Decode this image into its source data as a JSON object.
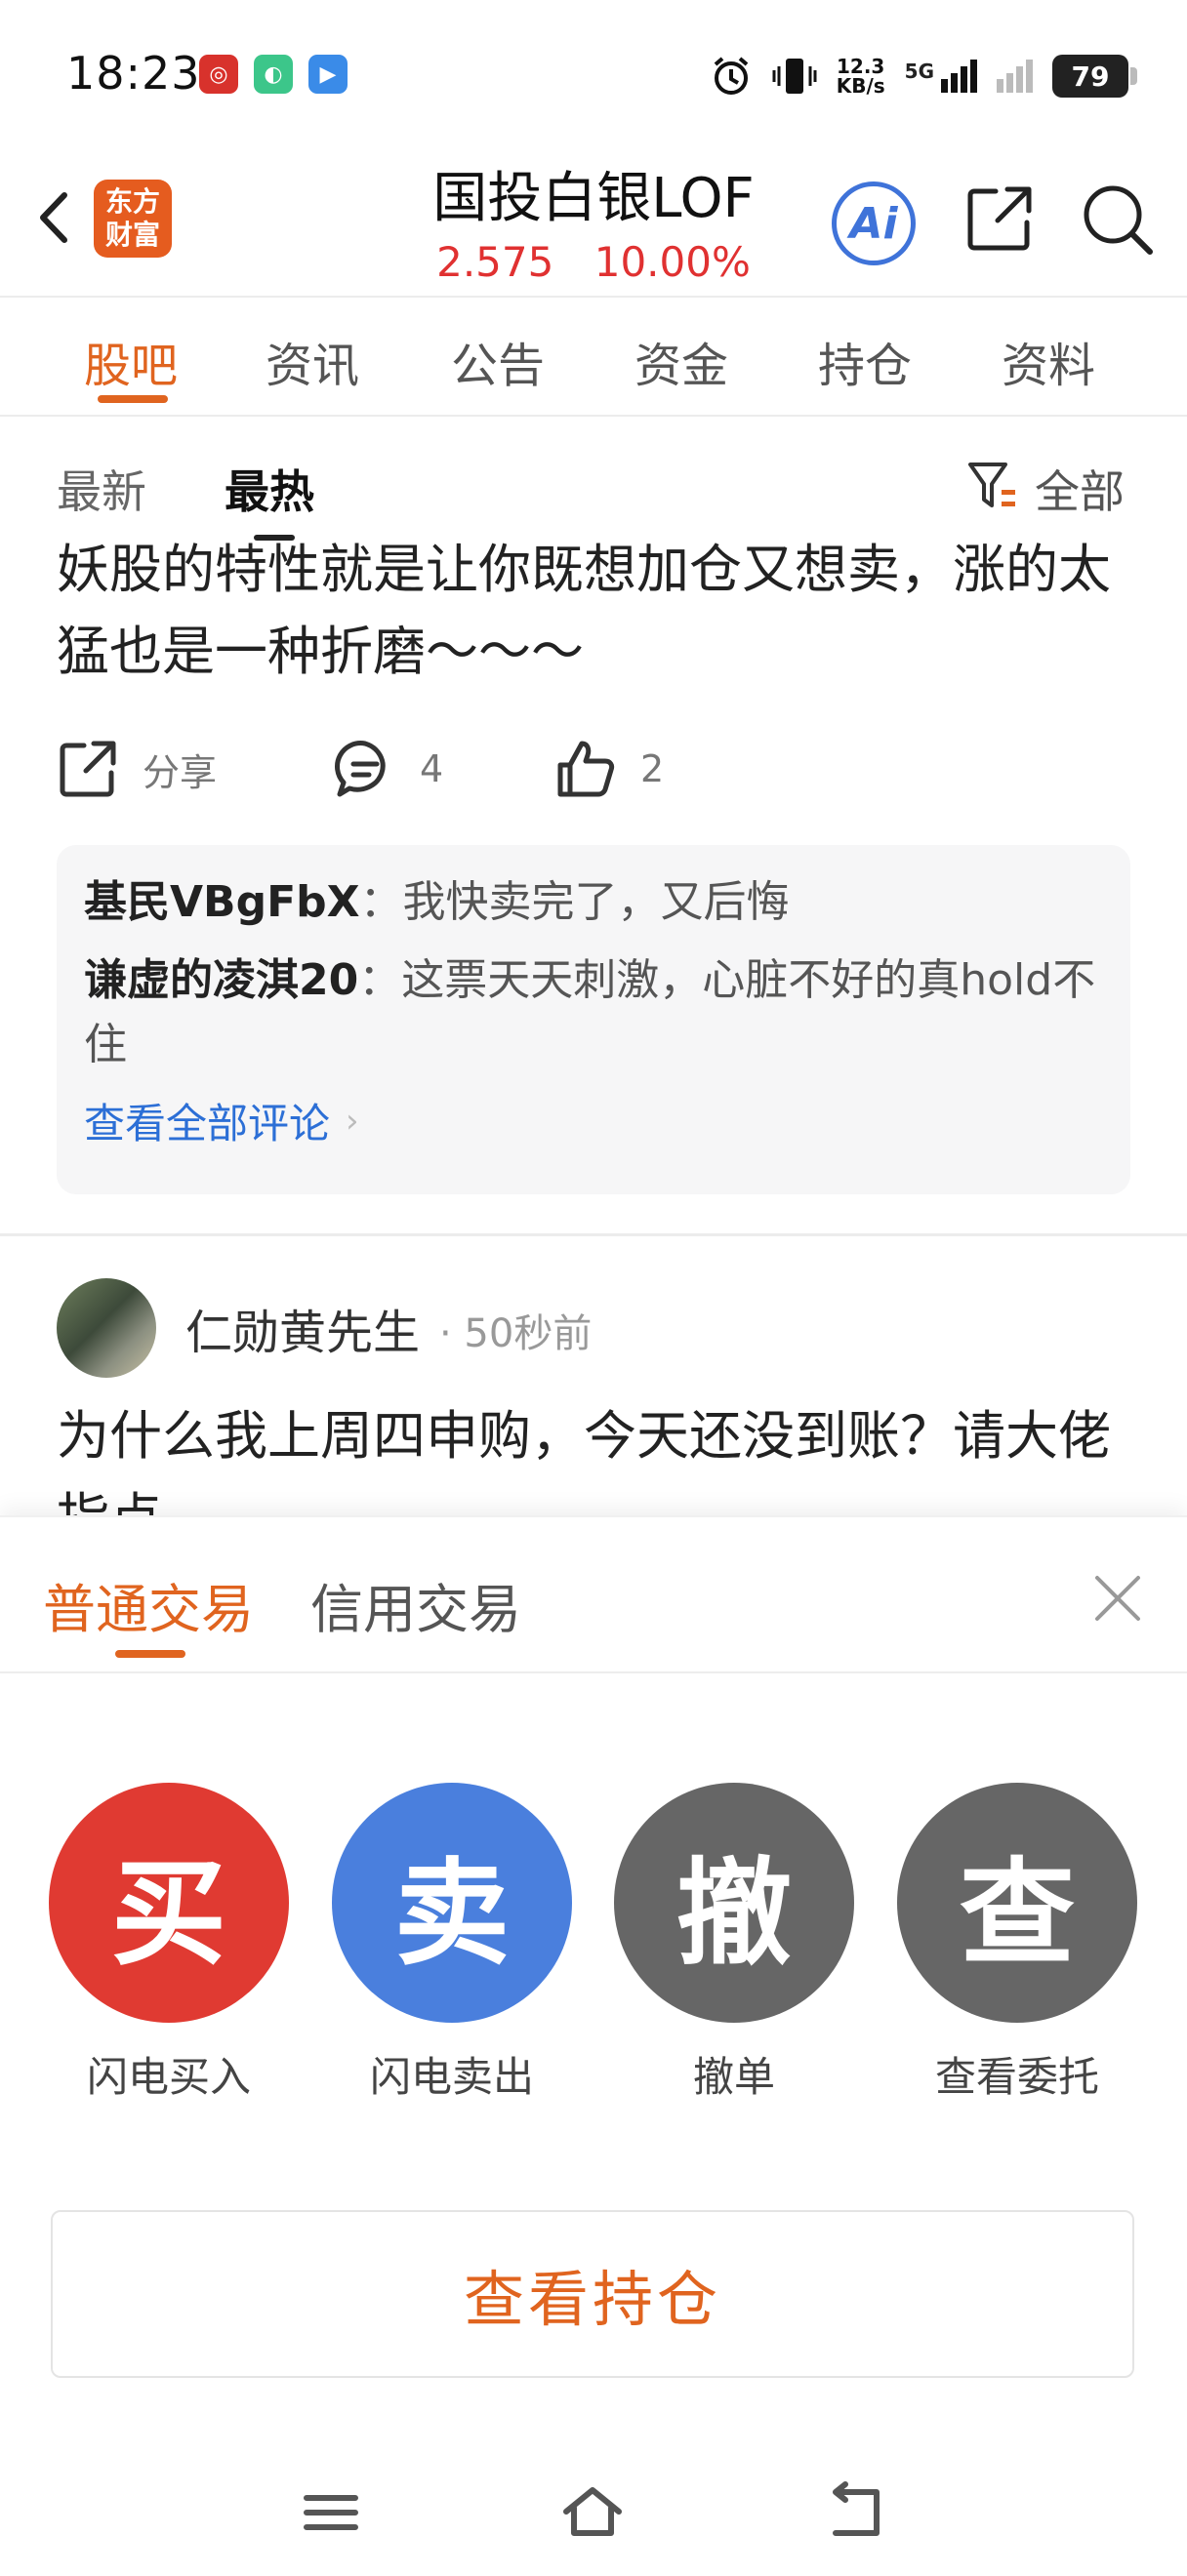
{
  "status_bar": {
    "time": "18:23",
    "speed_value": "12.3",
    "speed_unit": "KB/s",
    "network": "5G",
    "battery": "79",
    "icons": [
      "app-red-icon",
      "app-green-icon",
      "app-blue-icon",
      "alarm-icon",
      "vibrate-icon",
      "signal-icon",
      "signal-weak-icon"
    ]
  },
  "header": {
    "logo_line1": "东方",
    "logo_line2": "财富",
    "stock_name": "国投白银LOF",
    "price": "2.575",
    "change_pct": "10.00%",
    "ai_label": "Ai"
  },
  "tabs": [
    "股吧",
    "资讯",
    "公告",
    "资金",
    "持仓",
    "资料"
  ],
  "sort": {
    "latest": "最新",
    "hottest": "最热",
    "filter": "全部"
  },
  "post1": {
    "text": "妖股的特性就是让你既想加仓又想卖，涨的太猛也是一种折磨～～～",
    "share_label": "分享",
    "comment_count": "4",
    "like_count": "2",
    "comments": [
      {
        "user": "基民VBgFbX",
        "text": "：我快卖完了，又后悔"
      },
      {
        "user": "谦虚的凌淇20",
        "text": "：这票天天刺激，心脏不好的真hold不住"
      }
    ],
    "view_all": "查看全部评论"
  },
  "post2": {
    "author": "仁勋黄先生",
    "time": "· 50秒前",
    "text": "为什么我上周四申购，今天还没到账？请大佬指点"
  },
  "sheet": {
    "tab_normal": "普通交易",
    "tab_credit": "信用交易",
    "buttons": [
      {
        "glyph": "买",
        "label": "闪电买入",
        "color": "#e03a32"
      },
      {
        "glyph": "卖",
        "label": "闪电卖出",
        "color": "#4a7fdd"
      },
      {
        "glyph": "撤",
        "label": "撤单",
        "color": "#666666"
      },
      {
        "glyph": "查",
        "label": "查看委托",
        "color": "#666666"
      }
    ],
    "holdings": "查看持仓"
  },
  "colors": {
    "accent": "#e0641f",
    "up": "#e03131",
    "link": "#2c6fd6"
  }
}
